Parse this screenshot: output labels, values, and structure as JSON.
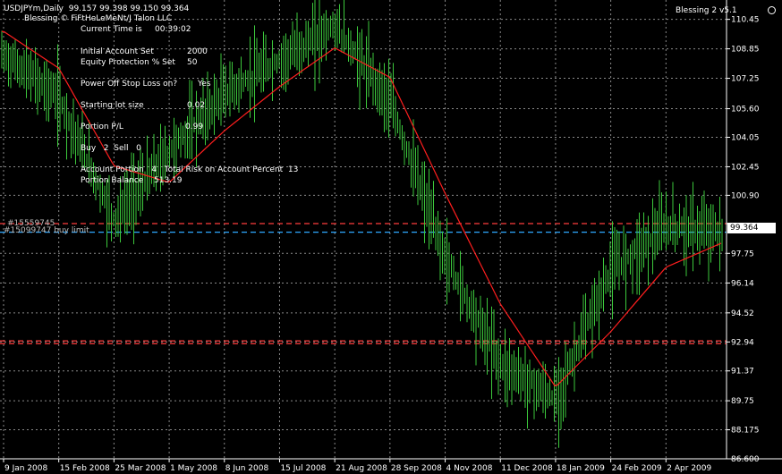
{
  "header": {
    "symbol_line": "USDJPYm,Daily  99.157 99.398 99.150 99.364",
    "copyright": "Blessing © FiFtHeLeMeNt/J Talon LLC",
    "ea_name": "Blessing 2 v5.1"
  },
  "info_panel": {
    "current_time_label": "Current Time is",
    "current_time_value": "00:39:02",
    "initial_account_label": "Initial Account Set",
    "initial_account_value": "2000",
    "equity_protection_label": "Equity Protection % Set",
    "equity_protection_value": "50",
    "power_off_label": "Power Off Stop Loss on?",
    "power_off_value": "Yes",
    "starting_lot_label": "Starting lot size",
    "starting_lot_value": "0.02",
    "portion_pl_label": "Portion P/L",
    "portion_pl_value": "0.99",
    "buy_sell_line": "Buy   2  Sell   0",
    "account_portion_line": "Account Portion   4   Total Risk on Account Percent  13",
    "portion_balance_label": "Portion Balance",
    "portion_balance_value": "513.19"
  },
  "order_labels": {
    "top_label": "#15559745",
    "buy_limit_label": "#15099747 buy limit"
  },
  "current_price_tag": "99.364",
  "colors": {
    "background": "#000000",
    "candles": "#3cc83c",
    "moving_average": "#ff1e1e",
    "grid": "#8a8a8a",
    "order_line": "#ff3c3c",
    "buy_limit_line": "#2ea8ff",
    "text": "#ffffff"
  },
  "chart_data": {
    "type": "line",
    "title": "USDJPYm,Daily",
    "xlabel": "",
    "ylabel": "",
    "grid": true,
    "y_axis_side": "right",
    "ylim": [
      86.6,
      111.5
    ],
    "y_ticks": [
      "110.45",
      "108.85",
      "107.25",
      "105.60",
      "104.05",
      "102.45",
      "100.90",
      "99.364",
      "97.75",
      "96.14",
      "94.52",
      "92.94",
      "91.37",
      "89.75",
      "88.175",
      "86.600"
    ],
    "x_ticks": [
      "9 Jan 2008",
      "15 Feb 2008",
      "25 Mar 2008",
      "1 May 2008",
      "8 Jun 2008",
      "15 Jul 2008",
      "21 Aug 2008",
      "28 Sep 2008",
      "4 Nov 2008",
      "11 Dec 2008",
      "18 Jan 2009",
      "24 Feb 2009",
      "2 Apr 2009"
    ],
    "x": [
      "9 Jan 2008",
      "15 Feb 2008",
      "25 Mar 2008",
      "1 May 2008",
      "8 Jun 2008",
      "15 Jul 2008",
      "21 Aug 2008",
      "28 Sep 2008",
      "4 Nov 2008",
      "11 Dec 2008",
      "18 Jan 2009",
      "24 Feb 2009",
      "2 Apr 2009",
      "15 Apr 2009"
    ],
    "series": [
      {
        "name": "",
        "values": [
          108.5,
          106.2,
          99.6,
          103.3,
          106.4,
          108.2,
          110.1,
          106.0,
          97.5,
          91.8,
          89.8,
          96.8,
          99.2,
          98.9
        ]
      },
      {
        "name": "",
        "values": [
          109.8,
          107.8,
          102.5,
          101.6,
          104.4,
          106.8,
          108.9,
          107.3,
          101.0,
          95.0,
          90.5,
          93.5,
          97.0,
          98.3
        ]
      }
    ],
    "horizontal_levels": [
      {
        "value": 99.364,
        "style": "dashed",
        "color": "#ff3c3c"
      },
      {
        "value": 98.9,
        "style": "dashed",
        "color": "#2ea8ff"
      },
      {
        "value": 93.0,
        "style": "dashed",
        "color": "#ff3c3c"
      },
      {
        "value": 92.85,
        "style": "dashed",
        "color": "#ff3c3c"
      }
    ]
  }
}
